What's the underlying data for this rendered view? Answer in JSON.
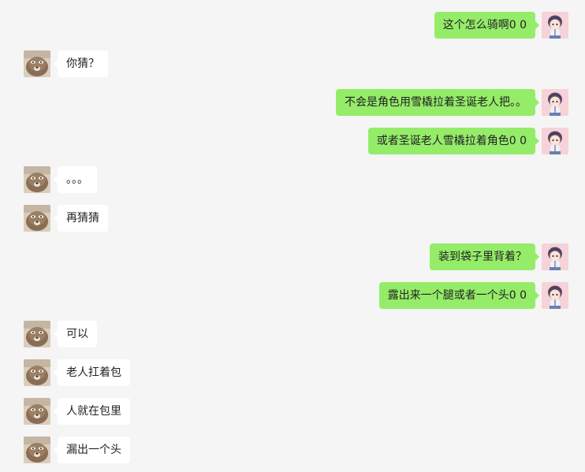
{
  "chat": {
    "messages": [
      {
        "side": "right",
        "text": "这个怎么骑啊0 0",
        "avatar": "anime-character-avatar"
      },
      {
        "side": "left",
        "text": "你猜？",
        "avatar": "dog-avatar"
      },
      {
        "side": "right",
        "text": "不会是角色用雪橇拉着圣诞老人把。。",
        "avatar": "anime-character-avatar"
      },
      {
        "side": "right",
        "text": "或者圣诞老人雪橇拉着角色0 0",
        "avatar": "anime-character-avatar"
      },
      {
        "side": "left",
        "text": "。。。",
        "avatar": "dog-avatar"
      },
      {
        "side": "left",
        "text": "再猜猜",
        "avatar": "dog-avatar"
      },
      {
        "side": "right",
        "text": "装到袋子里背着？",
        "avatar": "anime-character-avatar"
      },
      {
        "side": "right",
        "text": "露出来一个腿或者一个头0 0",
        "avatar": "anime-character-avatar"
      },
      {
        "side": "left",
        "text": "可以",
        "avatar": "dog-avatar"
      },
      {
        "side": "left",
        "text": "老人扛着包",
        "avatar": "dog-avatar"
      },
      {
        "side": "left",
        "text": "人就在包里",
        "avatar": "dog-avatar"
      },
      {
        "side": "left",
        "text": "漏出一个头",
        "avatar": "dog-avatar"
      }
    ]
  },
  "colors": {
    "background": "#f5f5f5",
    "self_bubble": "#95ec69",
    "other_bubble": "#ffffff"
  }
}
